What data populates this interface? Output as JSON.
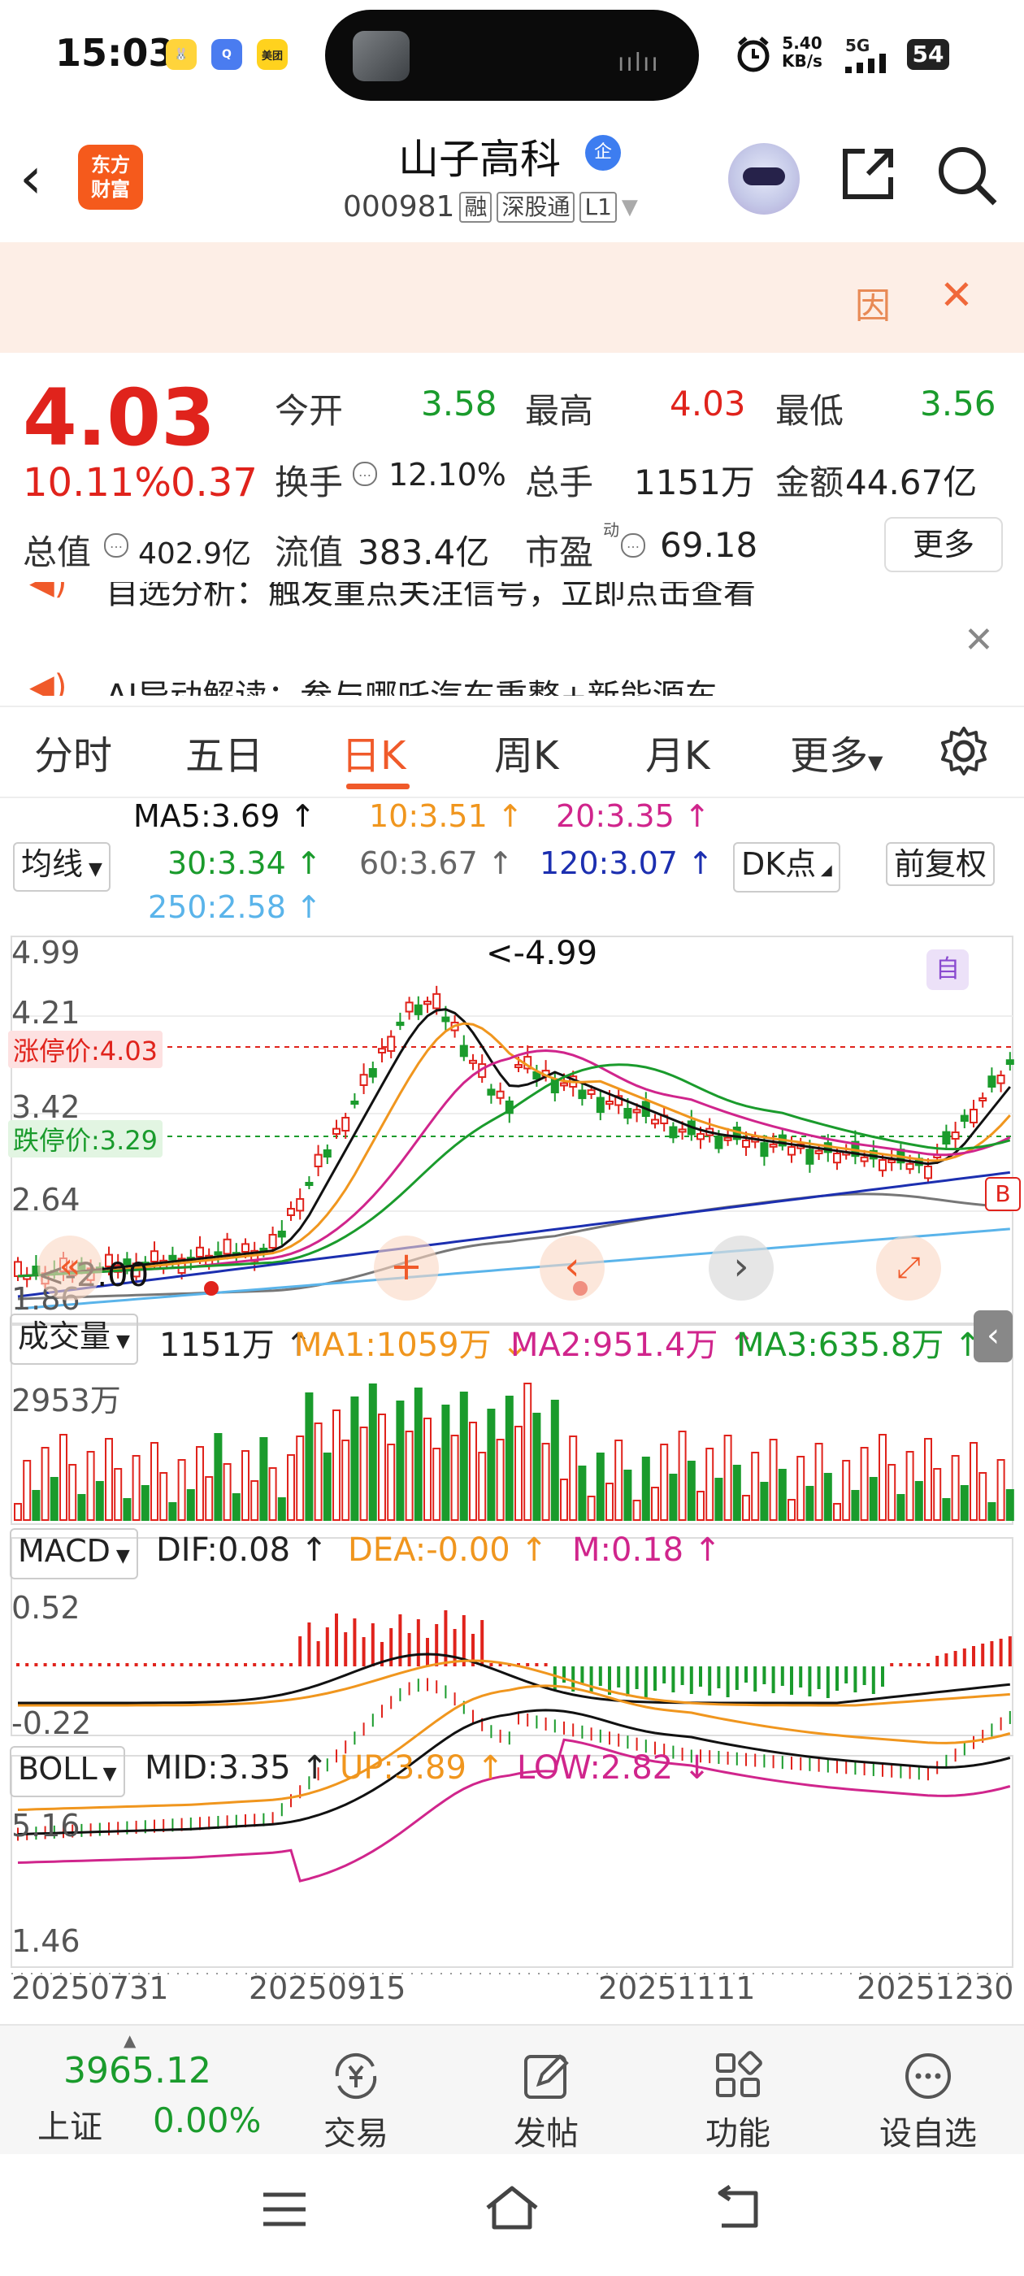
{
  "status_bar": {
    "time": "15:03",
    "net_speed": "5.40",
    "net_unit": "KB/s",
    "network": "5G",
    "battery": "54",
    "app_meituan": "美团"
  },
  "header": {
    "logo_line1": "东方",
    "logo_line2": "财富",
    "stock_name": "山子高科",
    "enterprise_badge": "企",
    "stock_code": "000981",
    "tag_margin": "融",
    "tag_connect": "深股通",
    "tag_level": "L1"
  },
  "notice": {
    "icon_text": "因"
  },
  "quote": {
    "price": "4.03",
    "change_pct": "10.11%",
    "change_amt": "0.37",
    "open_label": "今开",
    "open": "3.58",
    "high_label": "最高",
    "high": "4.03",
    "low_label": "最低",
    "low": "3.56",
    "turnover_label": "换手",
    "turnover": "12.10%",
    "volume_label": "总手",
    "volume": "1151万",
    "amount_label": "金额",
    "amount": "44.67亿",
    "mktcap_label": "总值",
    "mktcap": "402.9亿",
    "float_label": "流值",
    "float_cap": "383.4亿",
    "pe_label": "市盈",
    "pe_sup": "动",
    "pe": "69.18",
    "more_label": "更多"
  },
  "news": {
    "line1": "自选分析：触发重点关注信号，立即点击查看",
    "line2": "AI异动解读：参与哪吒汽车重整+新能源车"
  },
  "tabs": {
    "items": [
      "分时",
      "五日",
      "日K",
      "周K",
      "月K",
      "更多"
    ],
    "active": "日K"
  },
  "ma_legend": {
    "select_label": "均线",
    "ma5": "MA5:3.69 ↑",
    "ma10": "10:3.51 ↑",
    "ma20": "20:3.35 ↑",
    "ma30": "30:3.34 ↑",
    "ma60": "60:3.67 ↑",
    "ma120": "120:3.07 ↑",
    "ma250": "250:2.58 ↑",
    "dk_label": "DK点",
    "fq_label": "前复权"
  },
  "kline": {
    "y_labels": [
      "4.99",
      "4.21",
      "3.42",
      "2.64",
      "1.86"
    ],
    "peak_label": "<-4.99",
    "low_label": "<-2.00",
    "limit_up_label": "涨停价:4.03",
    "limit_down_label": "跌停价:3.29",
    "self_badge": "自",
    "b_badge": "B"
  },
  "volume_panel": {
    "select_label": "成交量",
    "vol": "1151万 ↑",
    "ma1": "MA1:1059万 ↓",
    "ma2": "MA2:951.4万 ↑",
    "ma3": "MA3:635.8万 ↑",
    "y_max": "2953万"
  },
  "macd_panel": {
    "select_label": "MACD",
    "dif": "DIF:0.08 ↑",
    "dea": "DEA:-0.00 ↑",
    "m": "M:0.18 ↑",
    "y_top": "0.52",
    "y_bottom": "-0.22"
  },
  "boll_panel": {
    "select_label": "BOLL",
    "mid": "MID:3.35 ↑",
    "up": "UP:3.89 ↑",
    "low": "LOW:2.82 ↓",
    "y_top": "5.16",
    "y_bottom": "1.46"
  },
  "x_axis": {
    "dates": [
      "20250731",
      "20250915",
      "20251111",
      "20251230"
    ]
  },
  "bottom_bar": {
    "index_value": "3965.12",
    "index_name": "上证",
    "index_change": "0.00%",
    "trade": "交易",
    "post": "发帖",
    "functions": "功能",
    "add_watch": "设自选"
  },
  "colors": {
    "up": "#e0231c",
    "down": "#1a9b2c",
    "accent": "#f05a2a",
    "ma5": "#111111",
    "ma10": "#f0961e",
    "ma20": "#d0258c",
    "ma30": "#1a9b2c",
    "ma60": "#777777",
    "ma120": "#1c2fb0",
    "ma250": "#5ab4ea"
  }
}
